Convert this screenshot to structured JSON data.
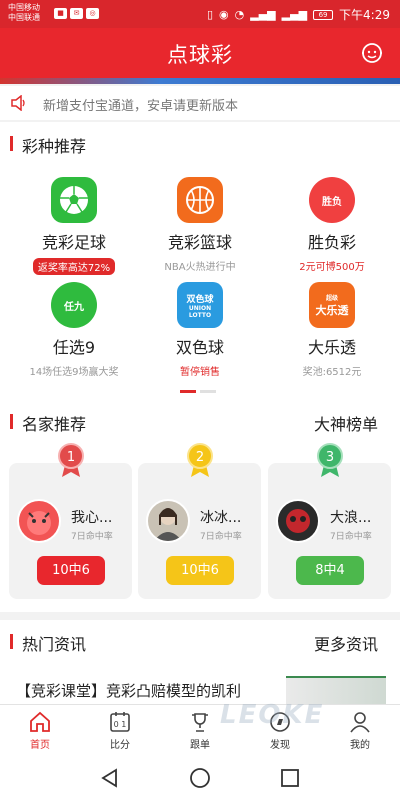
{
  "status_bar": {
    "carrier_1": "中国移动",
    "carrier_2": "中国联通",
    "battery": "69",
    "time": "下午4:29"
  },
  "header": {
    "title": "点球彩"
  },
  "notice": {
    "text": "新增支付宝通道，安卓请更新版本"
  },
  "lottery": {
    "title": "彩种推荐",
    "items": [
      {
        "name": "竞彩足球",
        "sub": "返奖率高达72%",
        "color": "#2fbb3e",
        "icon": "soccer-ball-icon"
      },
      {
        "name": "竞彩篮球",
        "sub": "NBA火热进行中",
        "color": "#f26b1d",
        "icon": "basketball-icon"
      },
      {
        "name": "胜负彩",
        "sub": "2元可博500万",
        "color": "#f04040",
        "icon": "shengfu-icon",
        "icon_text": "胜负"
      },
      {
        "name": "任选9",
        "sub": "14场任选9场赢大奖",
        "color": "#2fbb3e",
        "icon": "renxuan-icon",
        "icon_text": "任九"
      },
      {
        "name": "双色球",
        "sub": "暂停销售",
        "color": "#2a9be0",
        "icon": "union-lotto-icon",
        "icon_text": "双色球",
        "icon_text_2": "UNION LOTTO"
      },
      {
        "name": "大乐透",
        "sub": "奖池:6512元",
        "color": "#f26b1d",
        "icon": "daletou-icon",
        "icon_text": "大乐透",
        "icon_text_2": "超级"
      }
    ]
  },
  "experts": {
    "title": "名家推荐",
    "link": "大神榜单",
    "items": [
      {
        "rank": "1",
        "name": "我心...",
        "sub": "7日命中率",
        "rate": "10中6",
        "color": "#e8272d",
        "medal": "#e24b4b"
      },
      {
        "rank": "2",
        "name": "冰冰...",
        "sub": "7日命中率",
        "rate": "10中6",
        "color": "#f5c518",
        "medal": "#f5c518"
      },
      {
        "rank": "3",
        "name": "大浪...",
        "sub": "7日命中率",
        "rate": "8中4",
        "color": "#4cb84c",
        "medal": "#3fb66a"
      }
    ]
  },
  "news": {
    "title": "热门资讯",
    "link": "更多资讯",
    "headline": "【竞彩课堂】竞彩凸赔模型的凯利"
  },
  "tabs": [
    {
      "label": "首页",
      "icon": "home-icon"
    },
    {
      "label": "比分",
      "icon": "scoreboard-icon"
    },
    {
      "label": "跟单",
      "icon": "trophy-icon"
    },
    {
      "label": "发现",
      "icon": "discover-icon"
    },
    {
      "label": "我的",
      "icon": "profile-icon"
    }
  ],
  "watermark": "LEOKE"
}
